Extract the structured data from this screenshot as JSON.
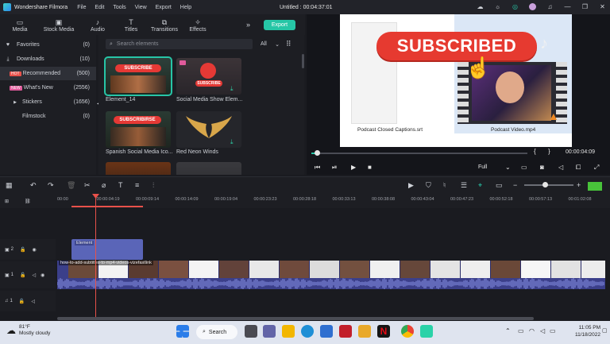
{
  "app": {
    "name": "Wondershare Filmora",
    "document_title": "Untitled : 00:04:37:01",
    "menu": [
      "File",
      "Edit",
      "Tools",
      "View",
      "Export",
      "Help"
    ]
  },
  "media_tabs": [
    {
      "label": "Media",
      "icon": "folder-icon"
    },
    {
      "label": "Stock Media",
      "icon": "stock-icon"
    },
    {
      "label": "Audio",
      "icon": "music-icon"
    },
    {
      "label": "Titles",
      "icon": "text-icon"
    },
    {
      "label": "Transitions",
      "icon": "transitions-icon"
    },
    {
      "label": "Effects",
      "icon": "effects-icon"
    }
  ],
  "export_label": "Export",
  "sidebar": {
    "items": [
      {
        "label": "Favorites",
        "count": "(0)",
        "icon": "heart-icon"
      },
      {
        "label": "Downloads",
        "count": "(10)",
        "icon": "download-icon"
      },
      {
        "label": "Recommended",
        "count": "(500)",
        "icon": "hot-badge",
        "badge": "HOT"
      },
      {
        "label": "What's New",
        "count": "(2556)",
        "icon": "new-badge",
        "badge": "NEW"
      },
      {
        "label": "Stickers",
        "count": "(1656)",
        "icon": "caret-right-icon"
      },
      {
        "label": "Filmstock",
        "count": "(0)",
        "icon": ""
      }
    ]
  },
  "elements": {
    "search_placeholder": "Search elements",
    "filter": "All",
    "cards": [
      {
        "label": "Element_14",
        "overlay": "SUBSCRIBE"
      },
      {
        "label": "Social Media Show Elem...",
        "overlay": "SUBSCRIBE"
      },
      {
        "label": "Spanish Social Media Ico...",
        "overlay": "SUBSCRIBIRSE"
      },
      {
        "label": "Red Neon Winds",
        "overlay": ""
      }
    ]
  },
  "preview": {
    "overlay_text": "SUBSCRIBED",
    "file_labels": [
      "Podcast Closed Captions.srt",
      "Podcast Video.mp4"
    ],
    "timecode": "00:00:04:09",
    "quality": "Full",
    "braces": [
      "{",
      "}"
    ]
  },
  "timeline": {
    "ticks": [
      "00:00",
      "00:00:04:19",
      "00:00:09:14",
      "00:00:14:09",
      "00:00:19:04",
      "00:00:23:23",
      "00:00:28:18",
      "00:00:33:13",
      "00:00:38:08",
      "00:00:43:04",
      "00:00:47:23",
      "00:00:52:18",
      "00:00:57:13",
      "00:01:02:08"
    ],
    "tracks": [
      {
        "number": "2",
        "kind": "video"
      },
      {
        "number": "1",
        "kind": "video"
      },
      {
        "number": "1",
        "kind": "audio"
      }
    ],
    "element_clip_label": "Element",
    "video_clip_label": "how-to-add-subtitles-to-mp4-videos-vizefastlink"
  },
  "taskbar": {
    "temperature": "81°F",
    "weather": "Mostly cloudy",
    "search_label": "Search",
    "time": "11:05 PM",
    "date": "11/18/2022"
  },
  "colors": {
    "accent": "#27c5a6",
    "playhead": "#e8514a",
    "clip_video": "#3b3f8a",
    "clip_element": "#5a65b8",
    "subscribe_red": "#e53935"
  }
}
